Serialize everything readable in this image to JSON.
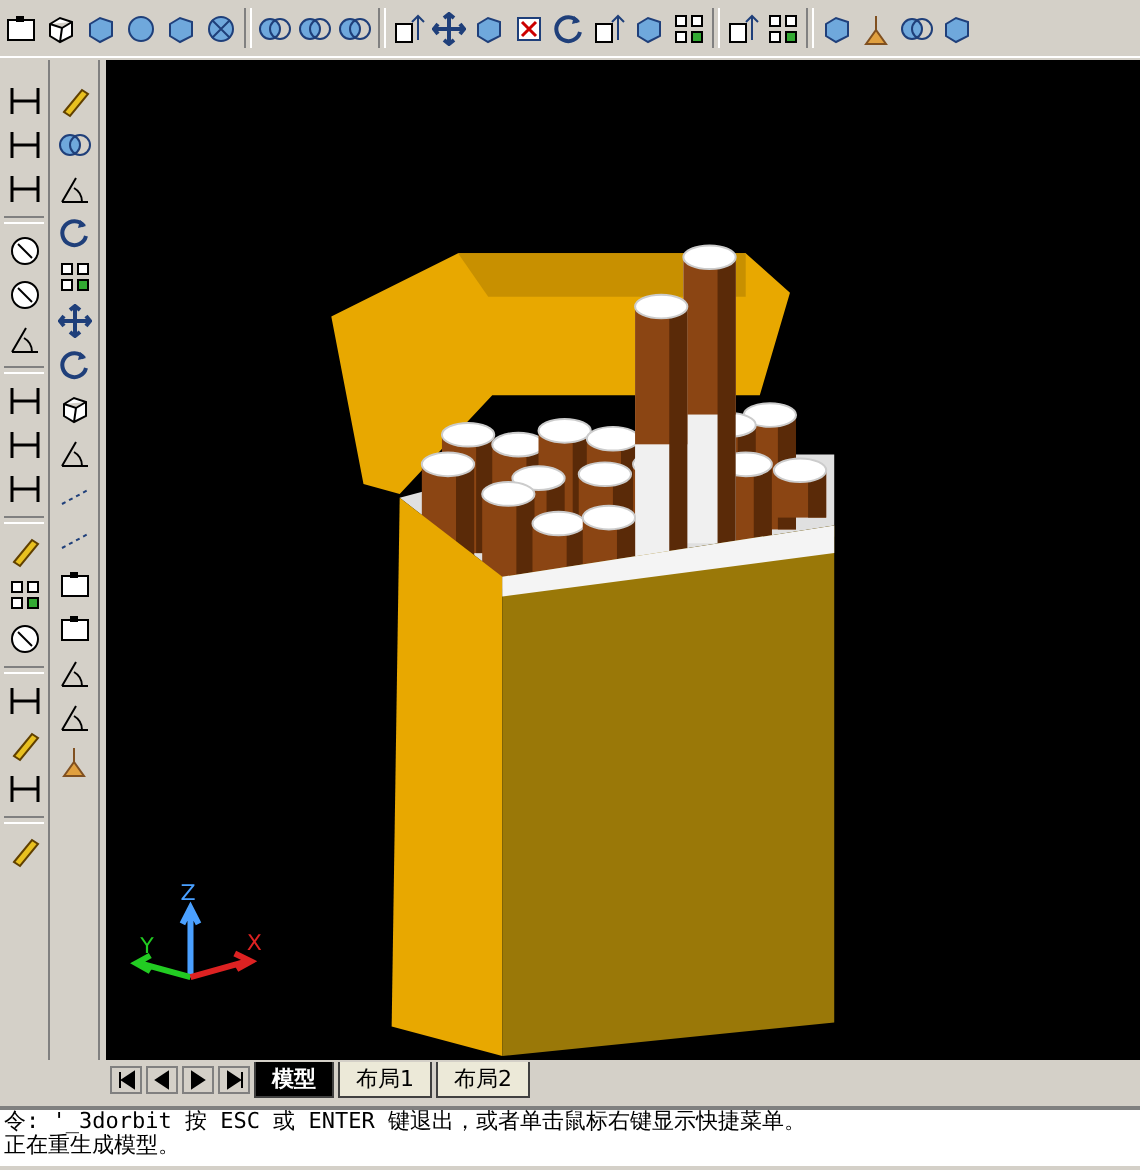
{
  "viewport": {
    "ucs": {
      "x": "X",
      "y": "Y",
      "z": "Z"
    }
  },
  "layout_tabs": [
    {
      "label": "模型",
      "selected": true
    },
    {
      "label": "布局1",
      "selected": false
    },
    {
      "label": "布局2",
      "selected": false
    }
  ],
  "command_line": [
    "令: '_3dorbit 按 ESC 或 ENTER 键退出，或者单击鼠标右键显示快捷菜单。",
    "正在重生成模型。"
  ]
}
